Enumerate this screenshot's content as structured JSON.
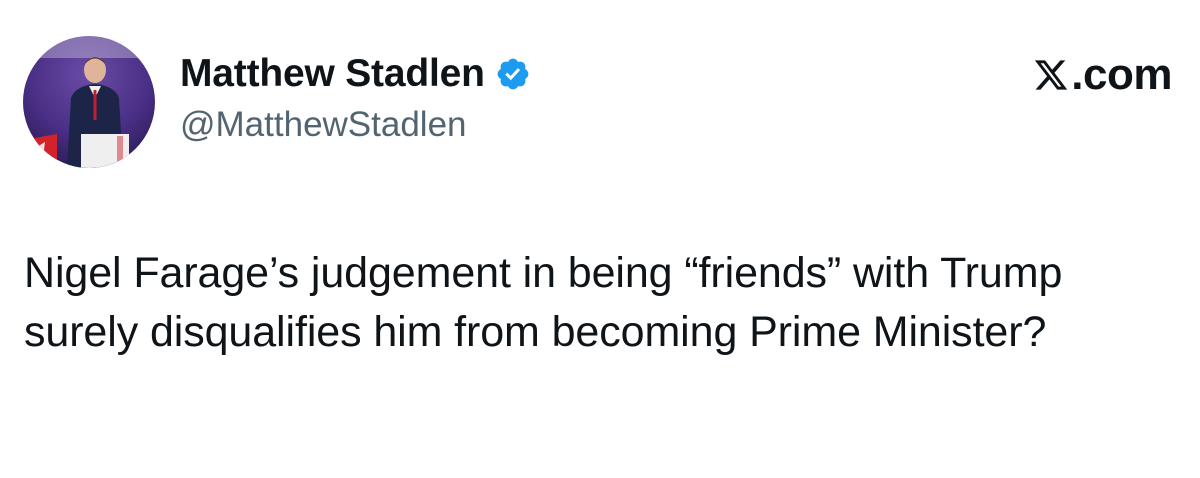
{
  "author": {
    "display_name": "Matthew Stadlen",
    "handle": "@MatthewStadlen",
    "verified": true,
    "verified_badge_color": "#1d9bf0",
    "avatar_icon": "profile-photo"
  },
  "brand": {
    "logo_icon": "x-logo-icon",
    "text": ".com"
  },
  "tweet": {
    "text": "Nigel Farage’s judgement in being “friends” with Trump surely disqualifies him from becoming Prime Minister?"
  },
  "colors": {
    "text_primary": "#0f1419",
    "text_secondary": "#536471",
    "background": "#ffffff"
  }
}
